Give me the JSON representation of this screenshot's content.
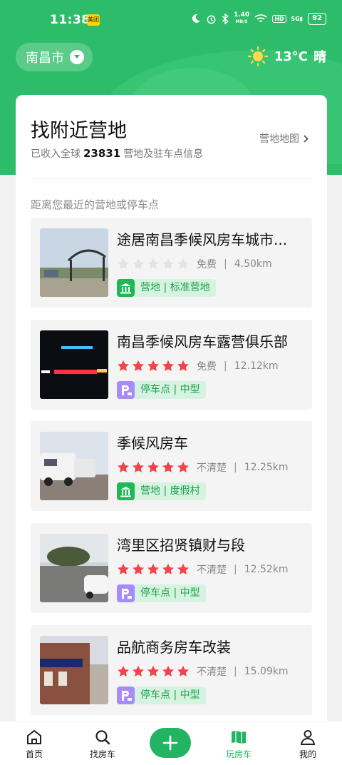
{
  "status_bar": {
    "time": "11:38",
    "badge": "美团",
    "speed_top": "1.40",
    "speed_bottom": "MB/S",
    "hd": "HD",
    "signal": "5G",
    "battery": "92"
  },
  "header": {
    "city": "南昌市",
    "temperature": "13°C",
    "weather": "晴"
  },
  "card": {
    "title": "找附近营地",
    "subtitle_prefix": "已收入全球",
    "count": "23831",
    "subtitle_suffix": "营地及驻车点信息",
    "map_link": "营地地图",
    "section_label": "距离您最近的营地或停车点"
  },
  "places": [
    {
      "name": "途居南昌季候风房车城市...",
      "rating": 0,
      "price": "免费",
      "distance": "4.50km",
      "tag_type": "camp",
      "tag": "营地 | 标准营地"
    },
    {
      "name": "南昌季候风房车露营俱乐部",
      "rating": 5,
      "price": "免费",
      "distance": "12.12km",
      "tag_type": "park",
      "tag": "停车点 | 中型"
    },
    {
      "name": "季候风房车",
      "rating": 5,
      "price": "不清楚",
      "distance": "12.25km",
      "tag_type": "camp",
      "tag": "营地 | 度假村"
    },
    {
      "name": "湾里区招贤镇财与段",
      "rating": 5,
      "price": "不清楚",
      "distance": "12.52km",
      "tag_type": "park",
      "tag": "停车点 | 中型"
    },
    {
      "name": "品航商务房车改装",
      "rating": 5,
      "price": "不清楚",
      "distance": "15.09km",
      "tag_type": "park",
      "tag": "停车点 | 中型"
    }
  ],
  "nav": {
    "home": "首页",
    "find": "找房车",
    "play": "玩房车",
    "mine": "我的"
  },
  "colors": {
    "brand_green": "#2dbd6a",
    "star_red": "#f0434a",
    "star_gray": "#e3e3e3"
  }
}
